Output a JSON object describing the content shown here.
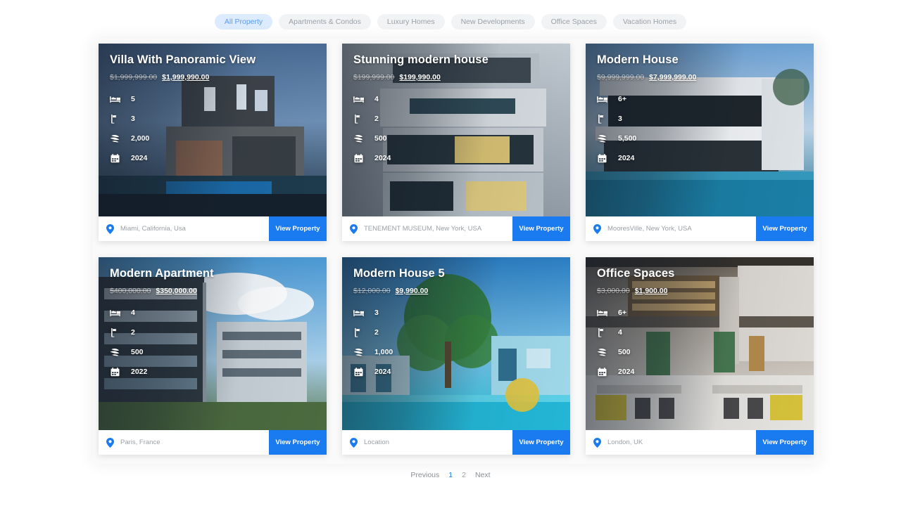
{
  "filters": {
    "tabs": [
      {
        "label": "All Property",
        "active": true
      },
      {
        "label": "Apartments & Condos",
        "active": false
      },
      {
        "label": "Luxury Homes",
        "active": false
      },
      {
        "label": "New Developments",
        "active": false
      },
      {
        "label": "Office Spaces",
        "active": false
      },
      {
        "label": "Vacation Homes",
        "active": false
      }
    ]
  },
  "colors": {
    "accent": "#1a7af0",
    "active_tab_bg": "#dcebfd",
    "active_tab_text": "#5b9bf0",
    "tab_bg": "#f2f3f5",
    "muted_text": "#9aa0a6",
    "panel_bg": "#fafafa"
  },
  "spec_icons": [
    "bed-icon",
    "bath-icon",
    "area-icon",
    "calendar-icon"
  ],
  "card_action_label": "View Property",
  "properties": [
    {
      "title": "Villa With Panoramic View",
      "price_old": "$1,999,999.00",
      "price_new": "$1,999,990.00",
      "beds": "5",
      "baths": "3",
      "area": "2,000",
      "year": "2024",
      "location": "Miami, California, Usa",
      "action": "View Property",
      "theme": "villa-dusk"
    },
    {
      "title": "Stunning modern house",
      "price_old": "$199,999.00",
      "price_new": "$199,990.00",
      "beds": "4",
      "baths": "2",
      "area": "500",
      "year": "2024",
      "location": "TENEMENT MUSEUM, New York, USA",
      "action": "View Property",
      "theme": "modern-grey"
    },
    {
      "title": "Modern House",
      "price_old": "$9,999,999.00",
      "price_new": "$7,999,999.00",
      "beds": "6+",
      "baths": "3",
      "area": "5,500",
      "year": "2024",
      "location": "MooresVille, New York, USA",
      "action": "View Property",
      "theme": "white-villa-pool"
    },
    {
      "title": "Modern Apartment",
      "price_old": "$400,000.00",
      "price_new": "$350,000.00",
      "beds": "4",
      "baths": "2",
      "area": "500",
      "year": "2022",
      "location": "Paris, France",
      "action": "View Property",
      "theme": "apartment-sky"
    },
    {
      "title": "Modern House 5",
      "price_old": "$12,000.00",
      "price_new": "$9,990.00",
      "beds": "3",
      "baths": "2",
      "area": "1,000",
      "year": "2024",
      "location": "Location",
      "action": "View Property",
      "theme": "tropical-pool"
    },
    {
      "title": "Office Spaces",
      "price_old": "$3,000.00",
      "price_new": "$1,900.00",
      "beds": "6+",
      "baths": "4",
      "area": "500",
      "year": "2024",
      "location": "London, UK",
      "action": "View Property",
      "theme": "office-interior"
    }
  ],
  "pagination": {
    "previous": "Previous",
    "pages": [
      "1",
      "2"
    ],
    "active_page": "1",
    "next": "Next"
  }
}
